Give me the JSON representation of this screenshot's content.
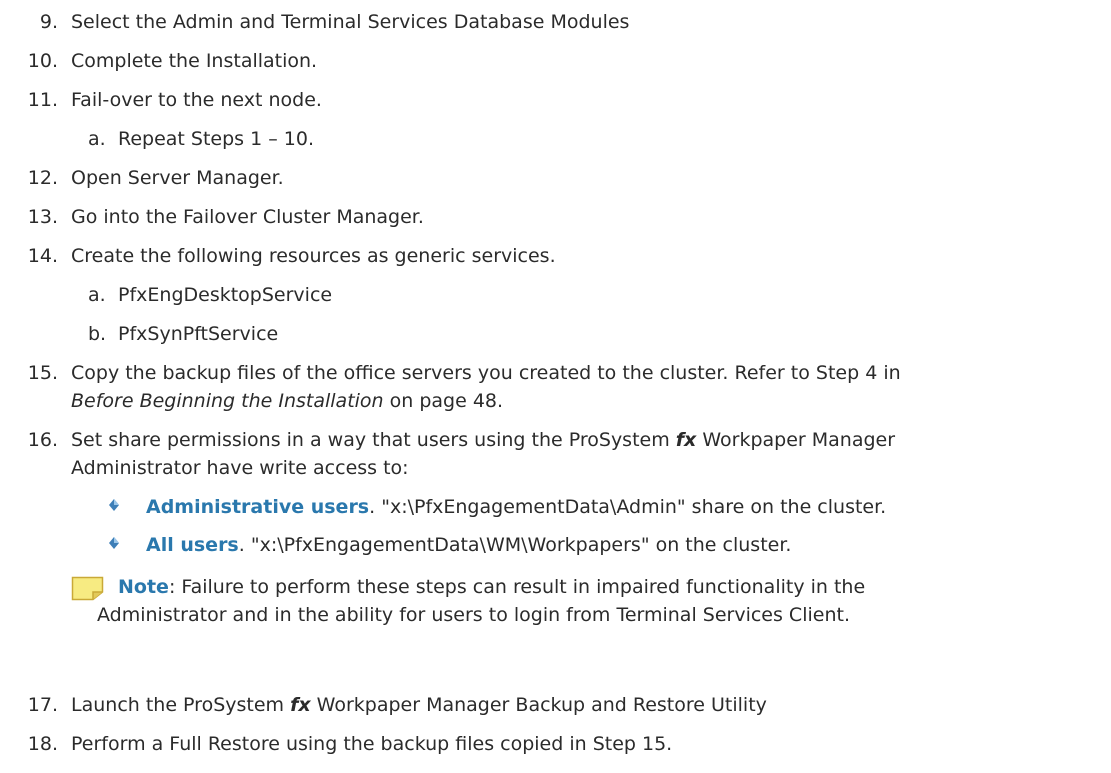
{
  "steps": [
    {
      "num": "9.",
      "text": "Select the Admin and Terminal Services Database Modules"
    },
    {
      "num": "10.",
      "text": "Complete the Installation."
    },
    {
      "num": "11.",
      "text": "Fail-over to the next node."
    },
    {
      "num": "12.",
      "text": "Open Server Manager."
    },
    {
      "num": "13.",
      "text": "Go into the Failover Cluster Manager."
    },
    {
      "num": "14.",
      "text": "Create the following resources as generic services."
    },
    {
      "num": "15.",
      "text": "Copy the backup files of the office servers you created to the cluster. Refer to Step 4 in"
    },
    {
      "num": "16.",
      "text_a": "Set share permissions in a way that users using the ProSystem ",
      "em": "fx",
      "text_b": " Workpaper Manager",
      "line2": "Administrator have write access to:"
    },
    {
      "num": "17.",
      "text_a": "Launch the ProSystem ",
      "em": "fx",
      "text_b": " Workpaper Manager Backup and Restore Utility"
    },
    {
      "num": "18.",
      "text": "Perform a Full Restore using the backup files copied in Step 15."
    }
  ],
  "step11_sub": {
    "letter": "a.",
    "text": "Repeat Steps 1 – 10."
  },
  "step14_sub": [
    {
      "letter": "a.",
      "text": "PfxEngDesktopService"
    },
    {
      "letter": "b.",
      "text": "PfxSynPftService"
    }
  ],
  "step15_ref": {
    "link": "Before Beginning the Installation",
    "rest": " on page 48."
  },
  "bullets": [
    {
      "label": "Administrative users",
      "text": ". \"x:\\PfxEngagementData\\Admin\" share on the cluster."
    },
    {
      "label": "All users",
      "text": ". \"x:\\PfxEngagementData\\WM\\Workpapers\" on the cluster."
    }
  ],
  "note": {
    "label": "Note",
    "line1": ": Failure to perform these steps can result in impaired functionality in the",
    "line2": "Administrator and in the ability for users to login from Terminal Services Client."
  },
  "colors": {
    "accent": "#2a78ad",
    "text": "#2b2b2b",
    "note_icon": "#f5e66e"
  }
}
